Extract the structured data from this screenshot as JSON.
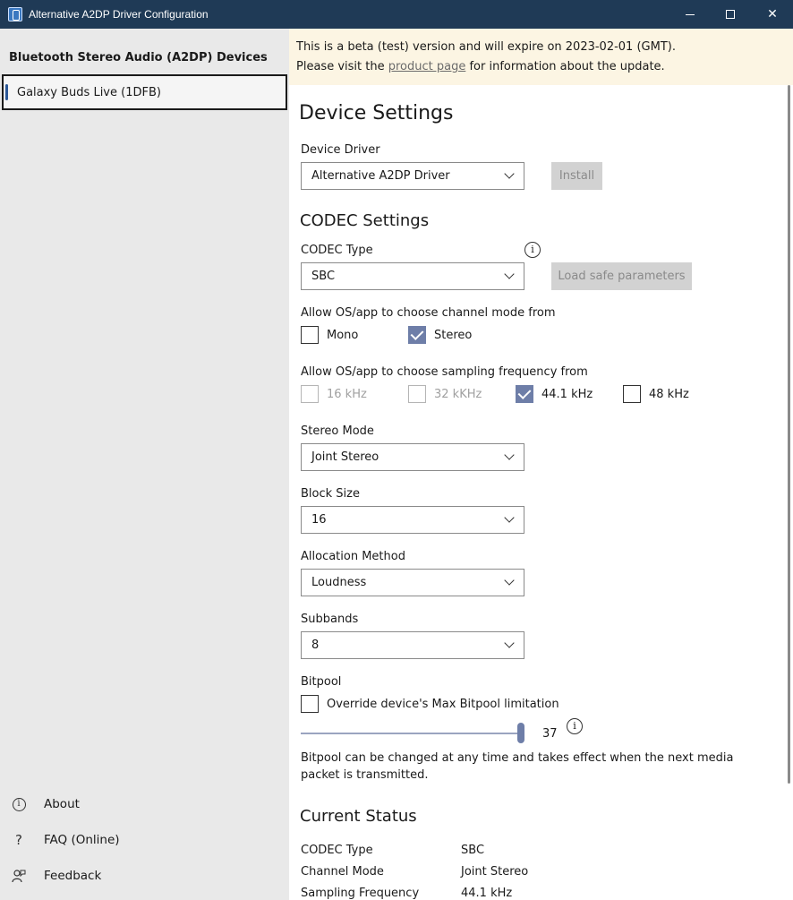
{
  "window": {
    "title": "Alternative A2DP Driver Configuration",
    "minimize": "",
    "maximize": "",
    "close": "✕"
  },
  "sidebar": {
    "heading": "Bluetooth Stereo Audio (A2DP) Devices",
    "devices": [
      "Galaxy Buds Live (1DFB)"
    ],
    "links": [
      {
        "icon": "info-icon",
        "label": "About"
      },
      {
        "icon": "question-icon",
        "label": "FAQ (Online)"
      },
      {
        "icon": "feedback-icon",
        "label": "Feedback"
      }
    ]
  },
  "banner": {
    "line1": "This is a beta (test) version and will expire on 2023-02-01 (GMT).",
    "line2_prefix": "Please visit the ",
    "link": "product page",
    "line2_suffix": " for information about the update."
  },
  "device_settings": {
    "title": "Device Settings",
    "driver_label": "Device Driver",
    "driver_value": "Alternative A2DP Driver",
    "install_button": "Install"
  },
  "codec_settings": {
    "title": "CODEC Settings",
    "codec_type_label": "CODEC Type",
    "codec_type_value": "SBC",
    "load_safe_button": "Load safe parameters",
    "channel_mode_label": "Allow OS/app to choose channel mode from",
    "channel_modes": [
      {
        "label": "Mono",
        "checked": false,
        "enabled": true
      },
      {
        "label": "Stereo",
        "checked": true,
        "enabled": true
      }
    ],
    "sampling_label": "Allow OS/app to choose sampling frequency from",
    "sampling_freqs": [
      {
        "label": "16 kHz",
        "checked": false,
        "enabled": false
      },
      {
        "label": "32 kKHz",
        "checked": false,
        "enabled": false
      },
      {
        "label": "44.1 kHz",
        "checked": true,
        "enabled": true
      },
      {
        "label": "48 kHz",
        "checked": false,
        "enabled": true
      }
    ],
    "stereo_mode_label": "Stereo Mode",
    "stereo_mode_value": "Joint Stereo",
    "block_size_label": "Block Size",
    "block_size_value": "16",
    "allocation_label": "Allocation Method",
    "allocation_value": "Loudness",
    "subbands_label": "Subbands",
    "subbands_value": "8",
    "bitpool_label": "Bitpool",
    "bitpool_override_label": "Override device's Max Bitpool limitation",
    "bitpool_override_checked": false,
    "bitpool_value": "37",
    "bitpool_note": "Bitpool can be changed at any time and takes effect when the next media packet is transmitted."
  },
  "current_status": {
    "title": "Current Status",
    "rows": [
      {
        "key": "CODEC Type",
        "value": "SBC"
      },
      {
        "key": "Channel Mode",
        "value": "Joint Stereo"
      },
      {
        "key": "Sampling Frequency",
        "value": "44.1 kHz"
      }
    ]
  },
  "colors": {
    "titlebar": "#1f3a56",
    "accent": "#6e7ea8",
    "banner": "#fcf5e3",
    "sidebar": "#e9e9e9"
  }
}
